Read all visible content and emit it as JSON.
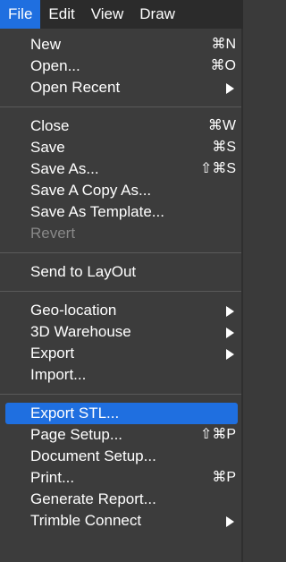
{
  "menubar": {
    "items": [
      {
        "label": "File"
      },
      {
        "label": "Edit"
      },
      {
        "label": "View"
      },
      {
        "label": "Draw"
      }
    ]
  },
  "menu": {
    "items": [
      {
        "label": "New",
        "shortcut": "⌘N"
      },
      {
        "label": "Open...",
        "shortcut": "⌘O"
      },
      {
        "label": "Open Recent"
      },
      {
        "label": "Close",
        "shortcut": "⌘W"
      },
      {
        "label": "Save",
        "shortcut": "⌘S"
      },
      {
        "label": "Save As...",
        "shortcut": "⇧⌘S"
      },
      {
        "label": "Save A Copy As..."
      },
      {
        "label": "Save As Template..."
      },
      {
        "label": "Revert"
      },
      {
        "label": "Send to LayOut"
      },
      {
        "label": "Geo-location"
      },
      {
        "label": "3D Warehouse"
      },
      {
        "label": "Export"
      },
      {
        "label": "Import..."
      },
      {
        "label": "Export STL..."
      },
      {
        "label": "Page Setup...",
        "shortcut": "⇧⌘P"
      },
      {
        "label": "Document Setup..."
      },
      {
        "label": "Print...",
        "shortcut": "⌘P"
      },
      {
        "label": "Generate Report..."
      },
      {
        "label": "Trimble Connect"
      }
    ]
  }
}
